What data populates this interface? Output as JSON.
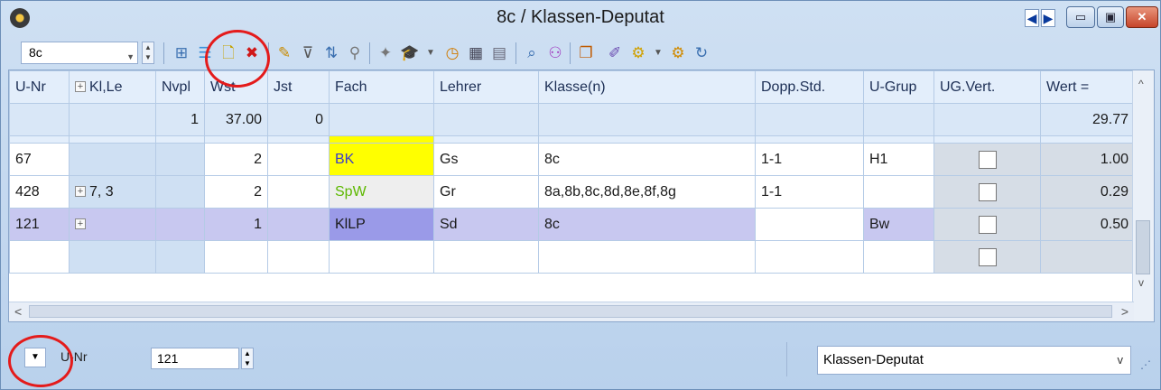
{
  "window": {
    "title": "8c / Klassen-Deputat"
  },
  "toolbar": {
    "class_value": "8c"
  },
  "grid": {
    "headers": [
      "U-Nr",
      "Kl,Le",
      "Nvpl",
      "Wst",
      "Jst",
      "Fach",
      "Lehrer",
      "Klasse(n)",
      "Dopp.Std.",
      "U-Grup",
      "UG.Vert.",
      "Wert ="
    ],
    "summary": {
      "nvpl": "1",
      "wst": "37.00",
      "jst": "0",
      "wert": "29.77"
    },
    "rows": [
      {
        "unr": "67",
        "klle": "",
        "wst": "2",
        "fach": "BK",
        "lehrer": "Gs",
        "klassen": "8c",
        "dopp": "1-1",
        "ugrup": "H1",
        "wert": "1.00"
      },
      {
        "unr": "428",
        "klle": "7, 3",
        "wst": "2",
        "fach": "SpW",
        "lehrer": "Gr",
        "klassen": "8a,8b,8c,8d,8e,8f,8g",
        "dopp": "1-1",
        "ugrup": "",
        "wert": "0.29"
      },
      {
        "unr": "121",
        "klle": "",
        "wst": "1",
        "fach": "KlLP",
        "lehrer": "Sd",
        "klassen": "8c",
        "dopp": "",
        "ugrup": "Bw",
        "wert": "0.50"
      }
    ]
  },
  "status": {
    "sort_label": "U-Nr",
    "sort_value": "121",
    "view_select": "Klassen-Deputat"
  },
  "colors": {
    "fach_bk": "#ffff00",
    "fach_spw": "#eeeeee",
    "selected_row": "#c8c8f0",
    "annotation": "#e41b1b"
  }
}
